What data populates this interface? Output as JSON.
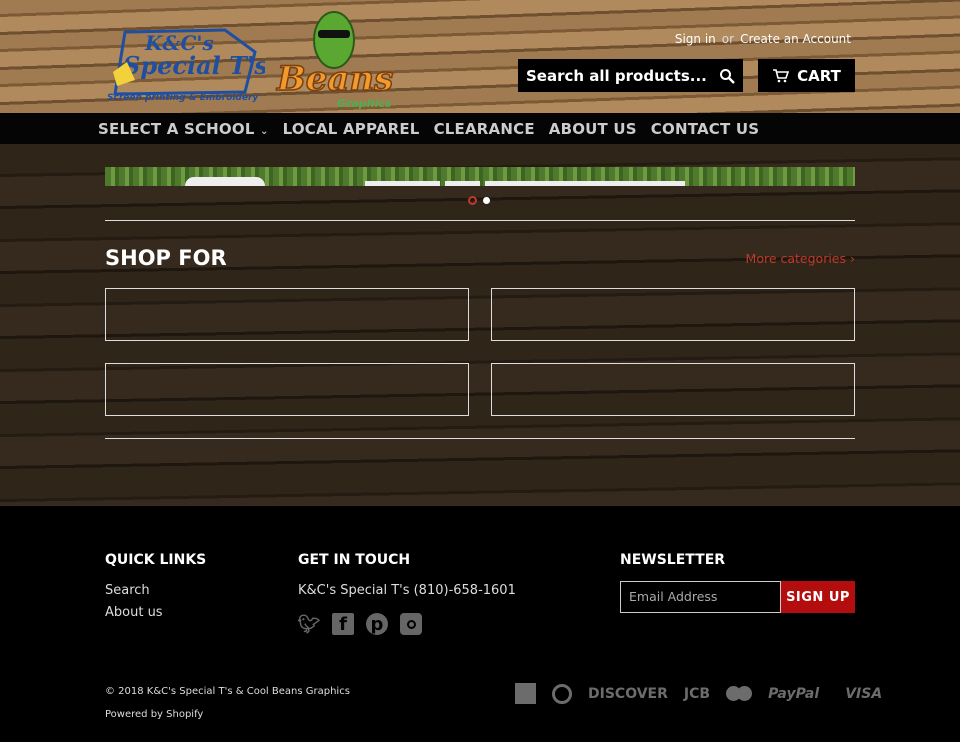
{
  "header": {
    "logo_left": "K&C's Special T's Inc - Screen printing & Embroidery",
    "logo_right": "Cool Beans Graphics",
    "sign_in": "Sign in",
    "or": "or",
    "create_account": "Create an Account",
    "search_placeholder": "Search all products...",
    "cart": "CART"
  },
  "nav": [
    "SELECT A SCHOOL",
    "LOCAL APPAREL",
    "CLEARANCE",
    "ABOUT US",
    "CONTACT US"
  ],
  "slider": {
    "active_dot": 1,
    "dot_count": 2,
    "active_color": "#c0392b"
  },
  "shop": {
    "title": "SHOP FOR",
    "more": "More categories ›"
  },
  "footer": {
    "quick_links": {
      "title": "QUICK LINKS",
      "items": [
        "Search",
        "About us"
      ]
    },
    "get_in_touch": {
      "title": "GET IN TOUCH",
      "contact": "K&C's Special T's (810)-658-1601",
      "social": [
        "twitter-icon",
        "facebook-icon",
        "pinterest-icon",
        "instagram-icon"
      ]
    },
    "newsletter": {
      "title": "NEWSLETTER",
      "placeholder": "Email Address",
      "button": "SIGN UP",
      "button_color": "#b40d0d"
    },
    "copyright": "© 2018 K&C's Special T's & Cool Beans Graphics",
    "powered": "Powered by Shopify",
    "payments": [
      "American Express",
      "Diners Club",
      "DISCOVER",
      "JCB",
      "Master",
      "PayPal",
      "VISA"
    ]
  }
}
